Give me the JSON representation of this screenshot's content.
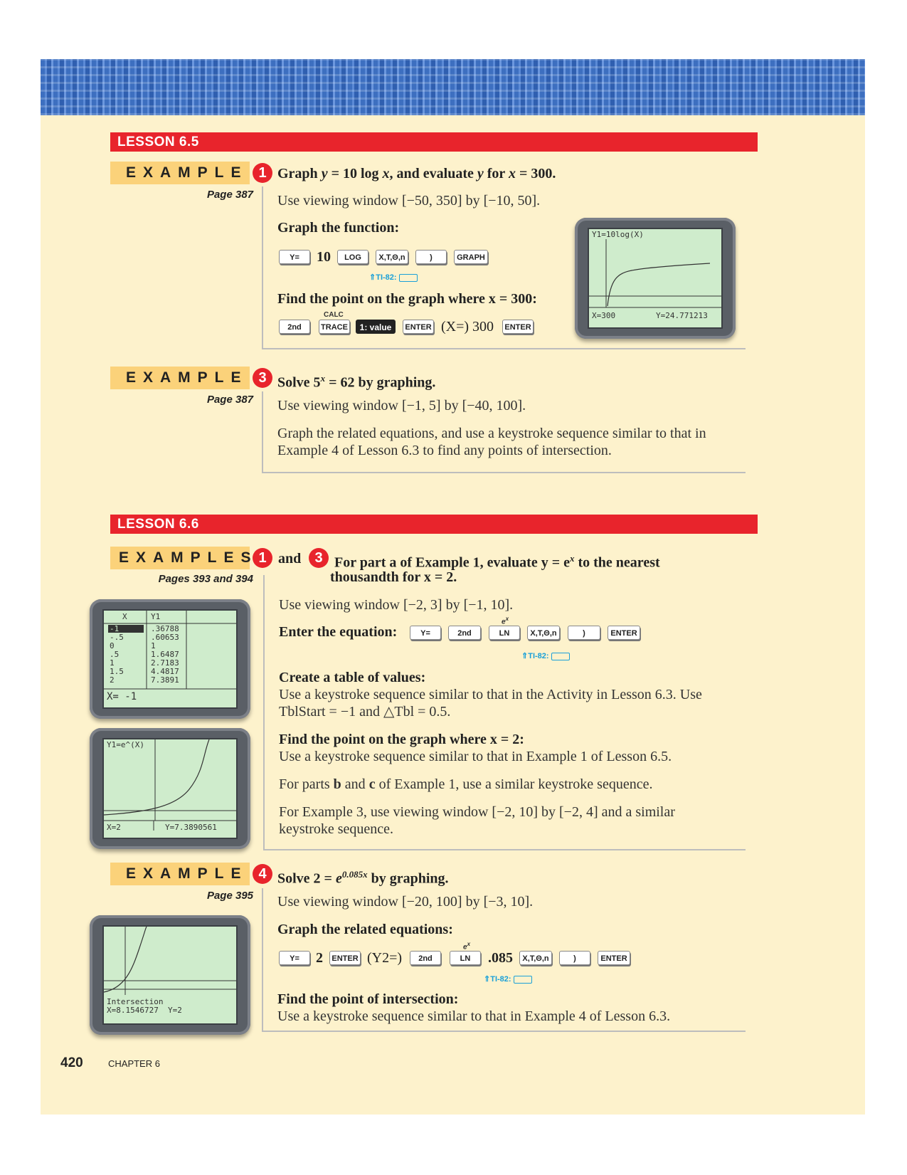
{
  "lesson65": {
    "label": "LESSON 6.5",
    "example1": {
      "tab": "EXAMPLE",
      "number": "1",
      "page": "Page 387",
      "title_a": "Graph ",
      "title_b": "y",
      "title_c": " = 10 log ",
      "title_d": "x",
      "title_e": ", and evaluate ",
      "title_f": "y",
      "title_g": " for ",
      "title_h": "x",
      "title_i": " = 300.",
      "window": "Use viewing window [−50, 350] by [−10, 50].",
      "graph_heading": "Graph the function:",
      "keys1": [
        "Y=",
        "10",
        "LOG",
        "X,T,Θ,n",
        ")",
        "GRAPH"
      ],
      "ti82": "TI-82:",
      "find_heading": "Find the point on the graph where x = 300:",
      "calc_label": "CALC",
      "keys2": [
        "2nd",
        "TRACE",
        "1: value",
        "ENTER",
        "(X=) 300",
        "ENTER"
      ],
      "screen": {
        "top": "Y1=10log(X)",
        "left": "X=300",
        "right": "Y=24.771213"
      }
    },
    "example3": {
      "tab": "EXAMPLE",
      "number": "3",
      "page": "Page 387",
      "title_a": "Solve 5",
      "title_sup": "x",
      "title_b": " = 62 by graphing.",
      "window": "Use viewing window [−1, 5] by [−40, 100].",
      "body": "Graph the related equations, and use a keystroke sequence similar to that in Example 4 of Lesson 6.3 to find any points of intersection."
    }
  },
  "lesson66": {
    "label": "LESSON 6.6",
    "examples13": {
      "tab": "EXAMPLES",
      "number_a": "1",
      "and": "and",
      "number_b": "3",
      "page": "Pages 393 and 394",
      "title_line1": "For part a of Example 1, evaluate y = e",
      "title_sup": "x",
      "title_line1_end": " to the nearest",
      "title_line2": "thousandth for x = 2.",
      "window": "Use viewing window [−2, 3] by [−1, 10].",
      "enter_heading": "Enter the equation:",
      "ex_label": "e",
      "ex_sup": "x",
      "keys": [
        "Y=",
        "2nd",
        "LN",
        "X,T,Θ,n",
        ")",
        "ENTER"
      ],
      "ti82": "TI-82:",
      "table_heading": "Create a table of values:",
      "table_body": "Use a keystroke sequence similar to that in the Activity in Lesson 6.3. Use TblStart = −1 and △Tbl = 0.5.",
      "find_heading": "Find the point on the graph where x = 2:",
      "find_body": "Use a keystroke sequence similar to that in Example 1 of Lesson 6.5.",
      "parts_a": "For parts ",
      "parts_b": "b",
      "parts_c": " and ",
      "parts_d": "c",
      "parts_e": " of Example 1, use a similar keystroke sequence.",
      "ex3_body": "For Example 3, use viewing window [−2, 10] by [−2, 4] and a similar keystroke sequence.",
      "table_screen": {
        "col_x": "X",
        "col_y": "Y1",
        "x_values": [
          "-1",
          "-.5",
          "0",
          ".5",
          "1",
          "1.5",
          "2"
        ],
        "y_values": [
          ".36788",
          ".60653",
          "1",
          "1.6487",
          "2.7183",
          "4.4817",
          "7.3891"
        ],
        "footer": "X= -1"
      },
      "graph_screen": {
        "top": "Y1=e^(X)",
        "left": "X=2",
        "right": "Y=7.3890561"
      }
    },
    "example4": {
      "tab": "EXAMPLE",
      "number": "4",
      "page": "Page 395",
      "title_a": "Solve 2 = ",
      "title_e": "e",
      "title_sup": "0.085x",
      "title_b": " by graphing.",
      "window": "Use viewing window [−20, 100] by [−3, 10].",
      "graph_heading": "Graph the related equations:",
      "ex_label": "e",
      "ex_sup": "x",
      "keys": [
        "Y=",
        "2",
        "ENTER",
        "(Y2=)",
        "2nd",
        "LN",
        ".085",
        "X,T,Θ,n",
        ")",
        "ENTER"
      ],
      "ti82": "TI-82:",
      "find_heading": "Find the point of intersection:",
      "find_body": "Use a keystroke sequence similar to that in Example 4 of Lesson 6.3.",
      "screen": {
        "line1": "Intersection",
        "line2": "X=8.1546727",
        "line2b": "Y=2"
      }
    }
  },
  "footer": {
    "page_number": "420",
    "chapter": "CHAPTER 6"
  },
  "colors": {
    "accent_red": "#e8242c",
    "tab_orange": "#fbd27a",
    "page_cream": "#fdf2cc",
    "ti82_blue": "#1aa0d8"
  }
}
